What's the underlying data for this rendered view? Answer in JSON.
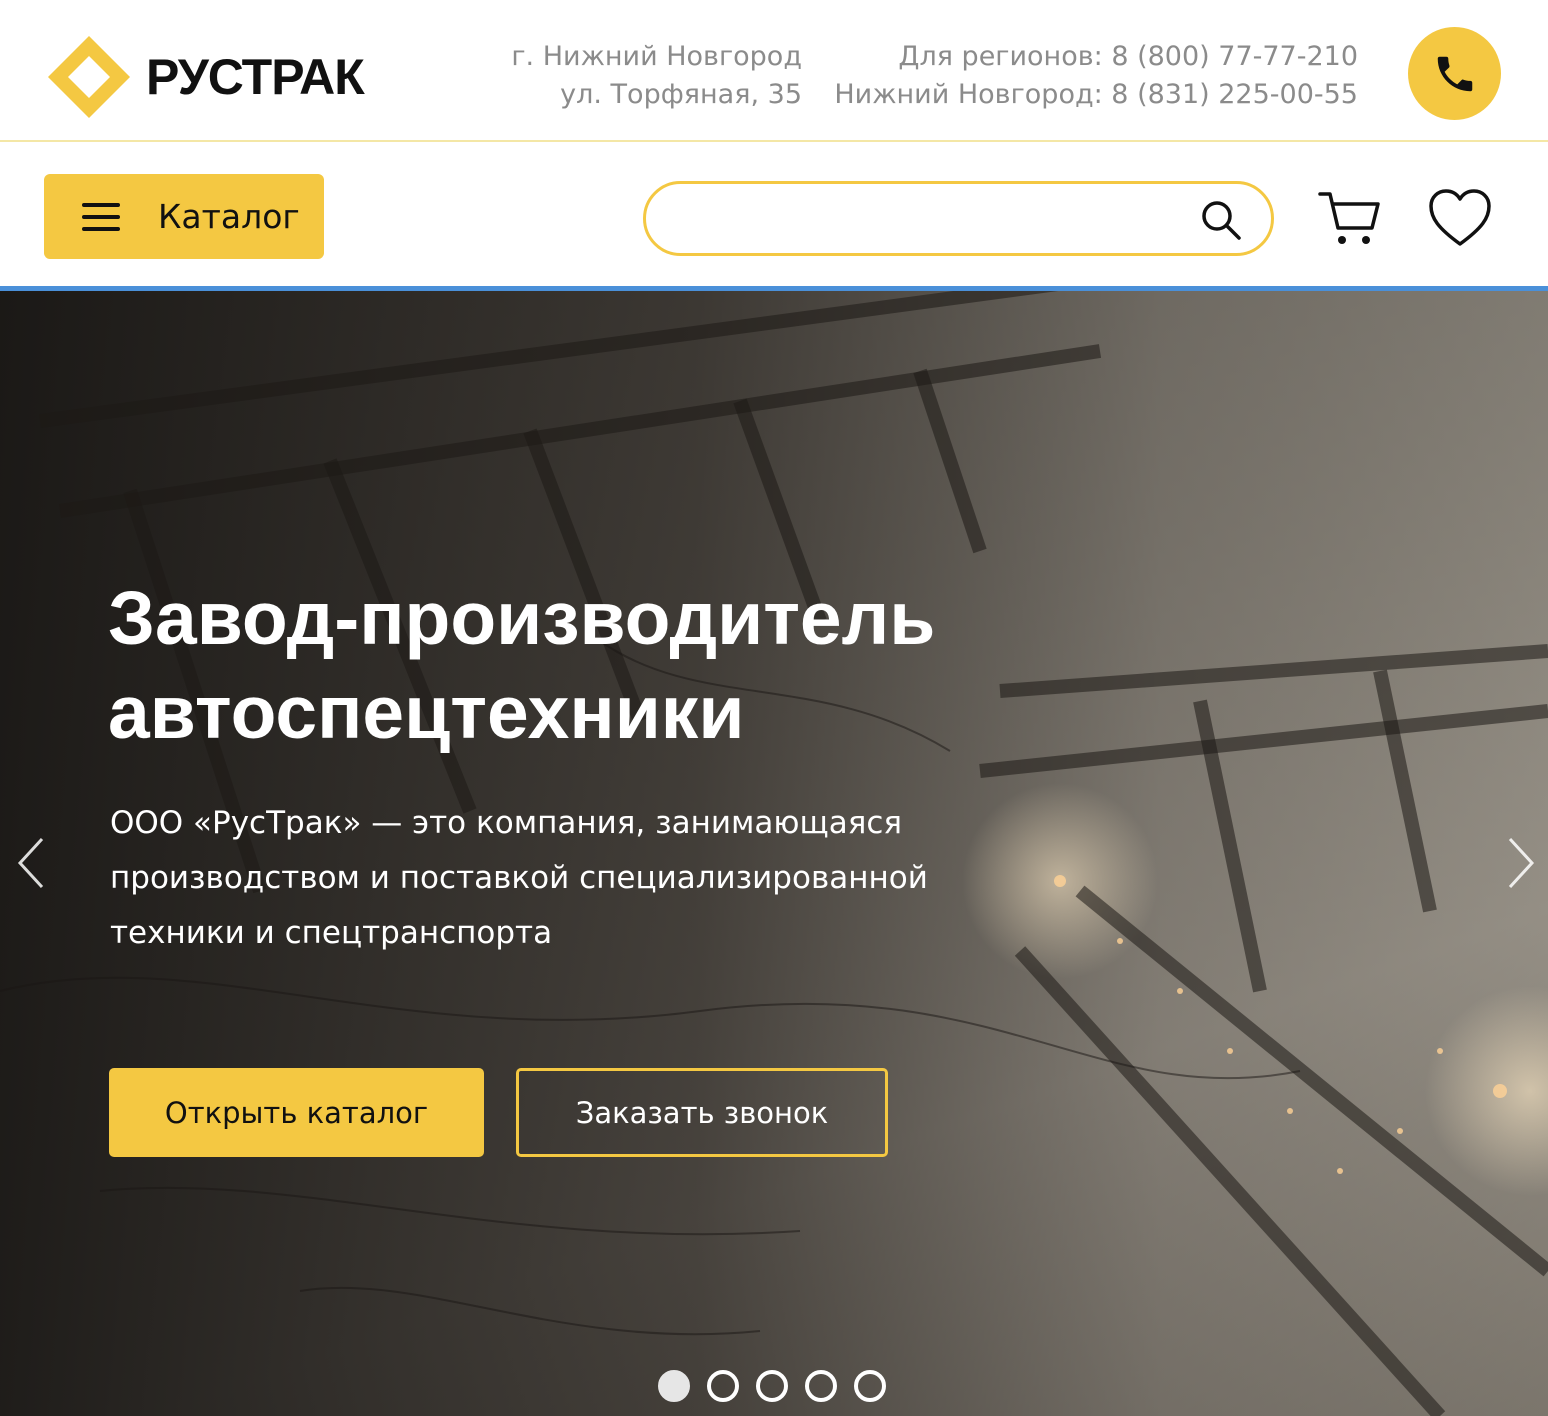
{
  "header": {
    "brand": "РУСТРАК",
    "address_line1": "г. Нижний Новгород",
    "address_line2": "ул. Торфяная, 35",
    "phone_regions": "Для регионов: 8 (800) 77-77-210",
    "phone_city": "Нижний Новгород: 8 (831) 225-00-55",
    "call_icon": "phone-icon"
  },
  "nav": {
    "catalog_label": "Каталог",
    "search_placeholder": "",
    "search_icon": "search-icon",
    "cart_icon": "cart-icon",
    "favorites_icon": "heart-icon"
  },
  "hero": {
    "title_line1": "Завод-производитель",
    "title_line2": "автоспецтехники",
    "desc_line1": "ООО «РусТрак» — это компания, занимающаяся",
    "desc_line2": "производством и поставкой специализированной",
    "desc_line3": "техники и спецтранспорта",
    "primary_button": "Открыть каталог",
    "secondary_button": "Заказать звонок",
    "slides_total": 5,
    "active_slide": 1
  },
  "colors": {
    "accent": "#f4c842",
    "nav_underline": "#4a90d9",
    "muted_text": "#8b8b8b"
  }
}
